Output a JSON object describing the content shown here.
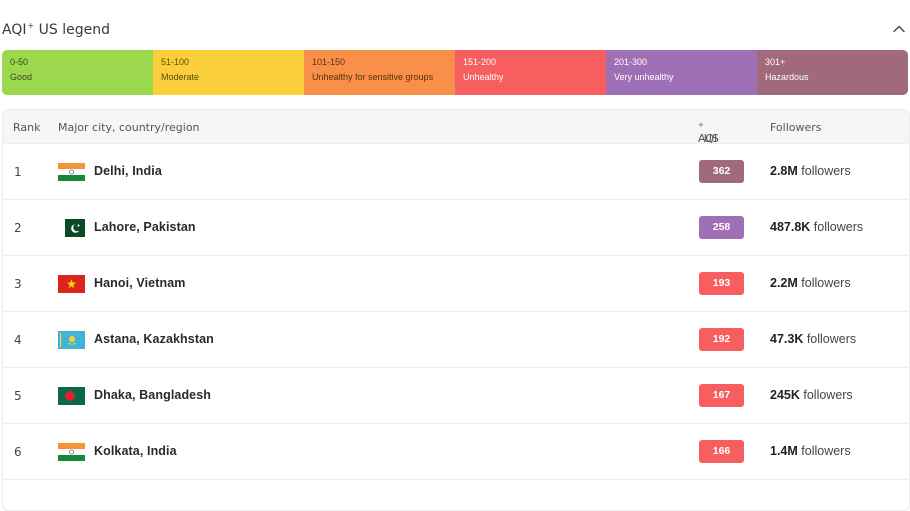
{
  "legend": {
    "title": "AQI",
    "title_sup": "+",
    "title_suffix": " US legend",
    "collapse_icon": "chevron-up-icon",
    "segments": [
      {
        "range": "0-50",
        "category": "Good",
        "color": "#9cd84e",
        "text_color": "#3a4a1e"
      },
      {
        "range": "51-100",
        "category": "Moderate",
        "color": "#facf39",
        "text_color": "#5a4a10"
      },
      {
        "range": "101-150",
        "category": "Unhealthy for sensitive groups",
        "color": "#f99049",
        "text_color": "#5a3010"
      },
      {
        "range": "151-200",
        "category": "Unhealthy",
        "color": "#f65e5f",
        "text_color": "#ffffff"
      },
      {
        "range": "201-300",
        "category": "Very unhealthy",
        "color": "#a070b6",
        "text_color": "#ffffff"
      },
      {
        "range": "301+",
        "category": "Hazardous",
        "color": "#a06a7b",
        "text_color": "#ffffff"
      }
    ]
  },
  "table": {
    "headers": {
      "rank": "Rank",
      "city": "Major city, country/region",
      "aqi": "AQI",
      "aqi_sup": "+",
      "aqi_suffix": " US",
      "followers": "Followers"
    },
    "rows": [
      {
        "rank": "1",
        "city": "Delhi, India",
        "flag": "india-flag-icon",
        "aqi": "362",
        "aqi_color": "#a06a7b",
        "followers_count": "2.8M",
        "followers_label": " followers"
      },
      {
        "rank": "2",
        "city": "Lahore, Pakistan",
        "flag": "pakistan-flag-icon",
        "aqi": "258",
        "aqi_color": "#a070b6",
        "followers_count": "487.8K",
        "followers_label": " followers"
      },
      {
        "rank": "3",
        "city": "Hanoi, Vietnam",
        "flag": "vietnam-flag-icon",
        "aqi": "193",
        "aqi_color": "#f65e5f",
        "followers_count": "2.2M",
        "followers_label": " followers"
      },
      {
        "rank": "4",
        "city": "Astana, Kazakhstan",
        "flag": "kazakhstan-flag-icon",
        "aqi": "192",
        "aqi_color": "#f65e5f",
        "followers_count": "47.3K",
        "followers_label": " followers"
      },
      {
        "rank": "5",
        "city": "Dhaka, Bangladesh",
        "flag": "bangladesh-flag-icon",
        "aqi": "167",
        "aqi_color": "#f65e5f",
        "followers_count": "245K",
        "followers_label": " followers"
      },
      {
        "rank": "6",
        "city": "Kolkata, India",
        "flag": "india-flag-icon",
        "aqi": "166",
        "aqi_color": "#f65e5f",
        "followers_count": "1.4M",
        "followers_label": " followers"
      }
    ]
  }
}
